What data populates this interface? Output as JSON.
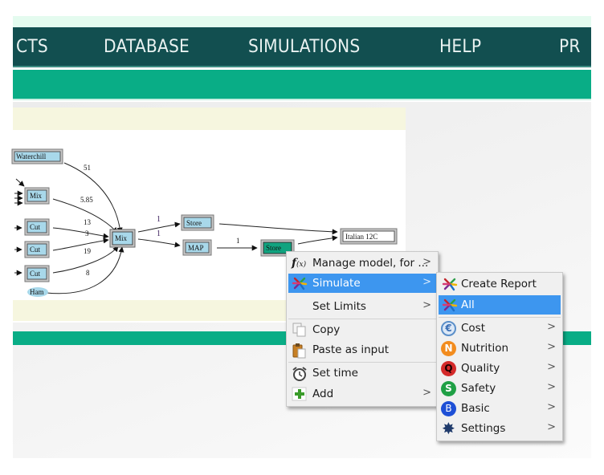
{
  "nav": {
    "items": [
      "CTS",
      "DATABASE",
      "SIMULATIONS",
      "HELP",
      "PR"
    ]
  },
  "graph": {
    "nodes": {
      "waterchill": "Waterchill",
      "mix_left": "Mix",
      "cut1": "Cut",
      "cut2": "Cut",
      "cut3": "Cut",
      "ham": "Ham",
      "mix_center": "Mix",
      "store_top": "Store",
      "map": "MAP",
      "store_selected": "Store",
      "italian": "Italian 12C"
    },
    "edge_labels": {
      "waterchill_mix": "51",
      "mixleft_mix": "5.85",
      "cut1_mix": "13",
      "cut2_mix_a": "3",
      "cut2_mix_b": "19",
      "cut3_mix": "8",
      "mix_store": "1",
      "mix_map": "1",
      "map_store": "1"
    }
  },
  "context_menu": {
    "items": [
      {
        "label": "Manage model, for ...",
        "icon": "function-icon",
        "submenu": true
      },
      {
        "label": "Simulate",
        "icon": "simulate-star-icon",
        "submenu": true,
        "highlighted": true
      },
      {
        "label": "Set Limits",
        "icon": "",
        "submenu": true
      },
      {
        "label": "Copy",
        "icon": "copy-icon",
        "submenu": false
      },
      {
        "label": "Paste as input",
        "icon": "paste-icon",
        "submenu": false
      },
      {
        "label": "Set time",
        "icon": "alarm-clock-icon",
        "submenu": false
      },
      {
        "label": "Add",
        "icon": "plus-icon",
        "submenu": true
      }
    ],
    "arrow": ">"
  },
  "submenu": {
    "items": [
      {
        "label": "Create Report",
        "icon": "simulate-star-icon",
        "submenu": false
      },
      {
        "label": "All",
        "icon": "simulate-star-icon",
        "submenu": false,
        "highlighted": true
      },
      {
        "label": "Cost",
        "icon": "euro-icon",
        "submenu": true,
        "badge": "€",
        "color": "#5b8fc9"
      },
      {
        "label": "Nutrition",
        "icon": "nutrition-n-icon",
        "submenu": true,
        "badge": "N",
        "color": "#f28c1e"
      },
      {
        "label": "Quality",
        "icon": "quality-q-icon",
        "submenu": true,
        "badge": "Q",
        "color": "#d42a2a"
      },
      {
        "label": "Safety",
        "icon": "safety-s-icon",
        "submenu": true,
        "badge": "S",
        "color": "#1fa045"
      },
      {
        "label": "Basic",
        "icon": "basic-b-icon",
        "submenu": true,
        "badge": "B",
        "color": "#1d4fd6"
      },
      {
        "label": "Settings",
        "icon": "gear-icon",
        "submenu": true
      }
    ],
    "arrow": ">"
  },
  "colors": {
    "navbar": "#124f50",
    "accent_green": "#09ad86",
    "highlight": "#3d96ef",
    "node_fill": "#a8d8ea",
    "selected_node_fill": "#10a37f"
  }
}
